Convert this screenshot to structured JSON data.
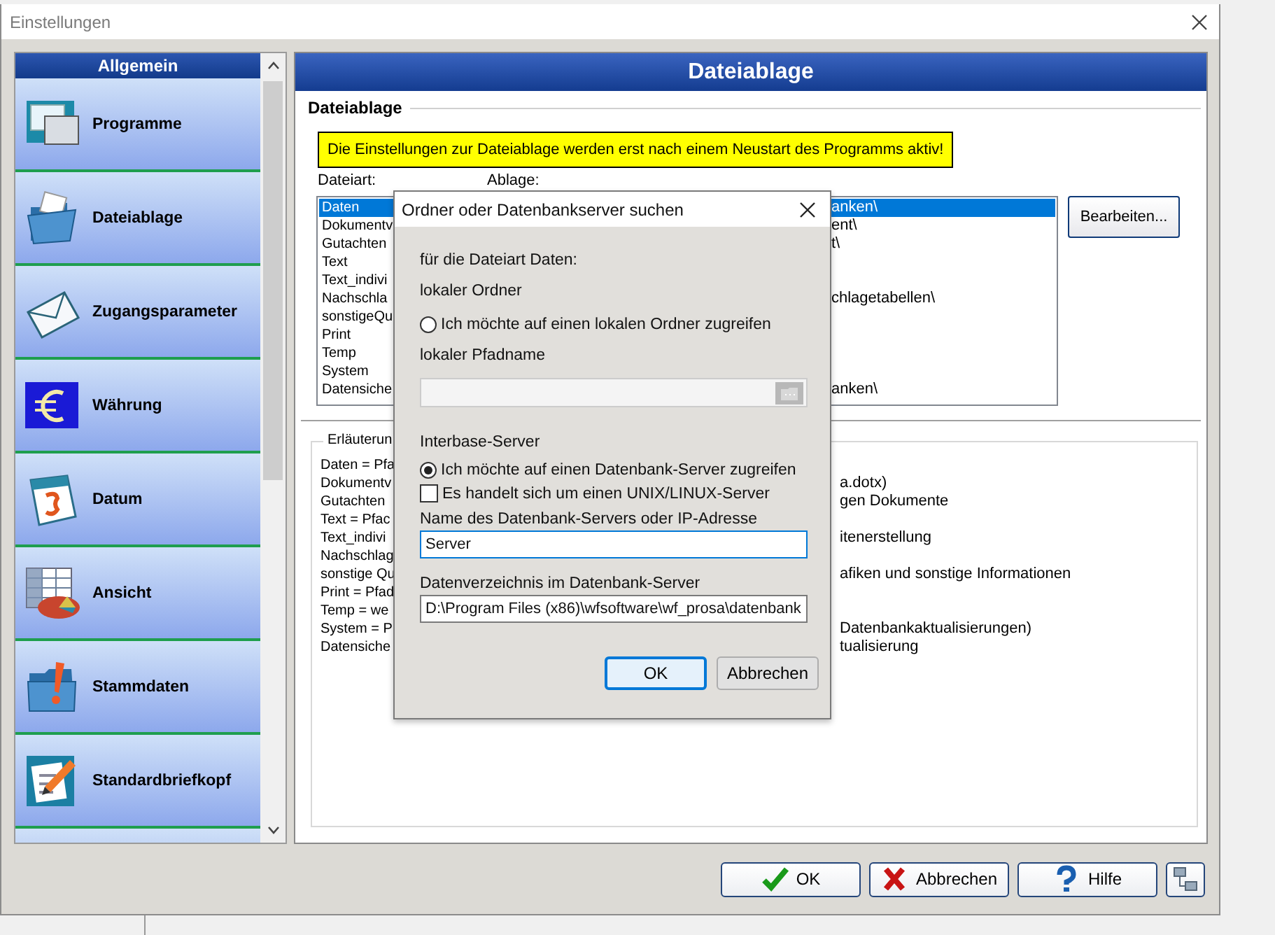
{
  "window": {
    "title": "Einstellungen"
  },
  "sidebar": {
    "header": "Allgemein",
    "items": [
      {
        "label": "Programme"
      },
      {
        "label": "Dateiablage"
      },
      {
        "label": "Zugangsparameter"
      },
      {
        "label": "Währung"
      },
      {
        "label": "Datum"
      },
      {
        "label": "Ansicht"
      },
      {
        "label": "Stammdaten"
      },
      {
        "label": "Standardbriefkopf"
      }
    ]
  },
  "panel": {
    "title": "Dateiablage",
    "group_title": "Dateiablage",
    "notice": "Die Einstellungen zur Dateiablage werden erst nach einem Neustart des Programms aktiv!",
    "list_labels": [
      "Dateiart:",
      "Ablage:"
    ],
    "file_types": [
      {
        "name": "Daten",
        "path": "anken\\",
        "selected": true
      },
      {
        "name": "Dokumentv",
        "path": "ent\\",
        "selected": false
      },
      {
        "name": "Gutachten",
        "path": "t\\",
        "selected": false
      },
      {
        "name": "Text",
        "selected": false
      },
      {
        "name": "Text_indivi",
        "selected": false
      },
      {
        "name": "Nachschla",
        "path": "chlagetabellen\\",
        "selected": false
      },
      {
        "name": "sonstigeQu",
        "selected": false
      },
      {
        "name": "Print",
        "selected": false
      },
      {
        "name": "Temp",
        "selected": false
      },
      {
        "name": "System",
        "selected": false
      },
      {
        "name": "Datensiche",
        "path": "anken\\",
        "selected": false
      }
    ],
    "edit_button": "Bearbeiten...",
    "explanation": {
      "title": "Erläuterun",
      "lines": [
        {
          "left": "Daten = Pfa"
        },
        {
          "left": "Dokumentv",
          "right": "a.dotx)"
        },
        {
          "left": "Gutachten",
          "right": "gen Dokumente"
        },
        {
          "left": "Text = Pfac"
        },
        {
          "left": "Text_indivi",
          "right": "itenerstellung"
        },
        {
          "left": "Nachschlag"
        },
        {
          "left": "sonstige Qu",
          "right": "afiken und sonstige Informationen"
        },
        {
          "left": "Print = Pfad"
        },
        {
          "left": "Temp =  we"
        },
        {
          "left": "System = P",
          "right": "Datenbankaktualisierungen)"
        },
        {
          "left": "Datensiche",
          "right": "tualisierung"
        }
      ]
    }
  },
  "dialog": {
    "title": "Ordner oder Datenbankserver suchen",
    "subtitle": "für die Dateiart Daten:",
    "local_section": "lokaler Ordner",
    "local_option": {
      "label": "Ich möchte auf einen lokalen Ordner zugreifen",
      "selected": false
    },
    "local_path_label": "lokaler Pfadname",
    "local_path": {
      "disabled": true
    },
    "server_section": "Interbase-Server",
    "server_option": {
      "label": "Ich möchte auf einen Datenbank-Server zugreifen",
      "selected": true
    },
    "unix_option": {
      "label": "Es handelt sich um einen UNIX/LINUX-Server",
      "checked": false
    },
    "server_name_label": "Name des Datenbank-Servers oder IP-Adresse",
    "server_name": {
      "value": "Server",
      "focused": true
    },
    "data_dir_label": "Datenverzeichnis im Datenbank-Server",
    "data_dir": {
      "value": "D:\\Program Files (x86)\\wfsoftware\\wf_prosa\\datenbank",
      "focused": false
    },
    "buttons": [
      {
        "label": "OK",
        "default": true
      },
      {
        "label": "Abbrechen",
        "default": false
      }
    ]
  },
  "footer": {
    "buttons": [
      {
        "label": "OK",
        "kind": "ok"
      },
      {
        "label": "Abbrechen",
        "kind": "cancel"
      },
      {
        "label": "Hilfe",
        "kind": "help"
      },
      {
        "kind": "network"
      }
    ]
  }
}
